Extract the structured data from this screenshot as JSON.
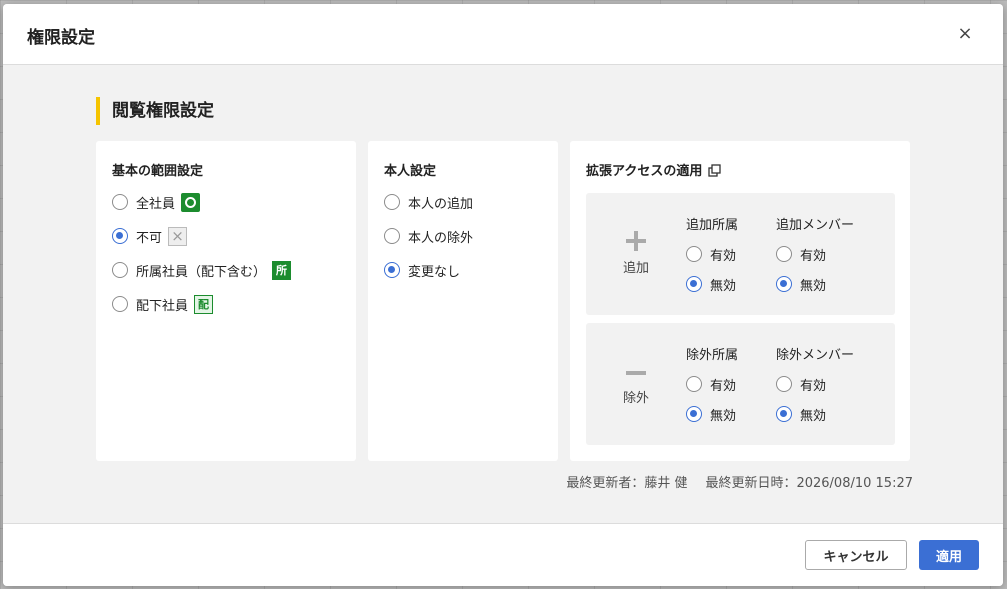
{
  "dialog": {
    "title": "権限設定",
    "close_label": "×"
  },
  "section": {
    "title": "閲覧権限設定"
  },
  "basic_scope": {
    "title": "基本の範囲設定",
    "options": [
      {
        "label": "全社員",
        "selected": false,
        "badge": "circle"
      },
      {
        "label": "不可",
        "selected": true,
        "badge": "×"
      },
      {
        "label": "所属社員（配下含む）",
        "selected": false,
        "badge": "所"
      },
      {
        "label": "配下社員",
        "selected": false,
        "badge": "配"
      }
    ]
  },
  "self_setting": {
    "title": "本人設定",
    "options": [
      {
        "label": "本人の追加",
        "selected": false
      },
      {
        "label": "本人の除外",
        "selected": false
      },
      {
        "label": "変更なし",
        "selected": true
      }
    ]
  },
  "extended_access": {
    "title": "拡張アクセスの適用",
    "icon": "external-link-icon",
    "add": {
      "sign": "+",
      "label": "追加",
      "dept": {
        "title": "追加所属",
        "options": [
          {
            "label": "有効",
            "selected": false
          },
          {
            "label": "無効",
            "selected": true
          }
        ]
      },
      "member": {
        "title": "追加メンバー",
        "options": [
          {
            "label": "有効",
            "selected": false
          },
          {
            "label": "無効",
            "selected": true
          }
        ]
      }
    },
    "exclude": {
      "sign": "−",
      "label": "除外",
      "dept": {
        "title": "除外所属",
        "options": [
          {
            "label": "有効",
            "selected": false
          },
          {
            "label": "無効",
            "selected": true
          }
        ]
      },
      "member": {
        "title": "除外メンバー",
        "options": [
          {
            "label": "有効",
            "selected": false
          },
          {
            "label": "無効",
            "selected": true
          }
        ]
      }
    }
  },
  "meta": {
    "updated_by": "最終更新者：藤井 健",
    "updated_at": "最終更新日時：2026/08/10 15:27"
  },
  "footer": {
    "cancel_label": "キャンセル",
    "apply_label": "適用"
  },
  "colors": {
    "accent": "#3b6fd4",
    "section_bar": "#f5c400",
    "badge_green": "#1c8c2e"
  }
}
